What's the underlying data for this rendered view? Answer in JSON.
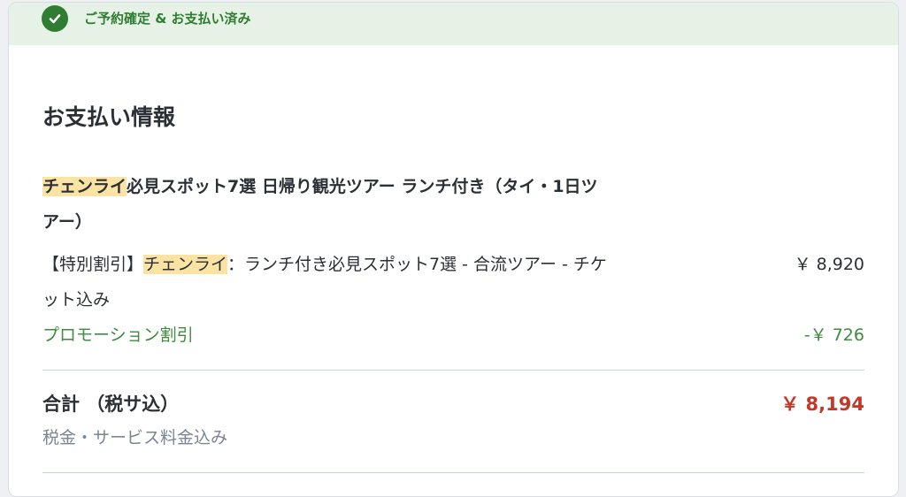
{
  "banner": {
    "icon": "check-circle-icon",
    "text": "ご予約確定 & お支払い済み",
    "color": "#2f7d32"
  },
  "payment": {
    "section_title": "お支払い情報",
    "tour_title_highlight": "チェンライ",
    "tour_title_rest": "必見スポット7選 日帰り観光ツアー ランチ付き（タイ・1日ツアー）",
    "item": {
      "prefix": "【特別割引】",
      "highlight": "チェンライ",
      "rest": "：ランチ付き必見スポット7選 - 合流ツアー - チケット込み",
      "price": "￥ 8,920"
    },
    "promotion": {
      "label": "プロモーション割引",
      "value": "-￥ 726"
    },
    "total": {
      "label": "合計 （税サ込）",
      "value": "￥ 8,194"
    },
    "tax_note": "税金・サービス料金込み"
  }
}
